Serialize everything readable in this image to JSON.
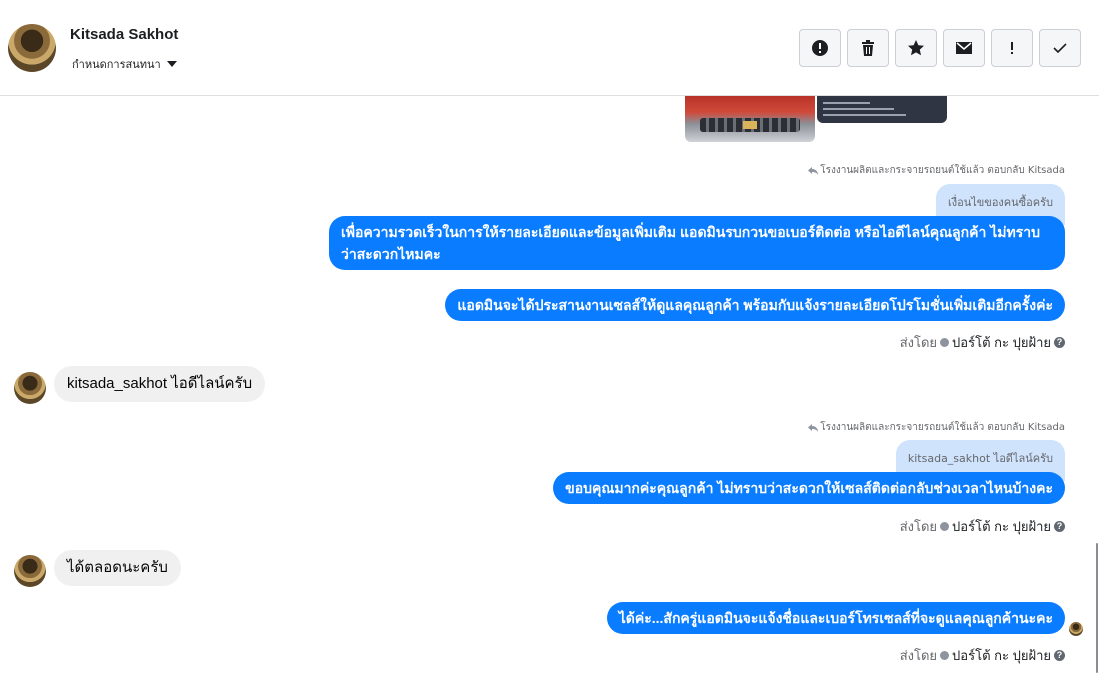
{
  "header": {
    "contact_name": "Kitsada Sakhot",
    "conversation_settings": "กำหนดการสนทนา",
    "actions": [
      {
        "name": "spam-button",
        "icon": "exclamation-circle-icon"
      },
      {
        "name": "delete-button",
        "icon": "trash-icon"
      },
      {
        "name": "star-button",
        "icon": "star-icon"
      },
      {
        "name": "mark-unread-button",
        "icon": "envelope-icon"
      },
      {
        "name": "important-button",
        "icon": "exclamation-icon"
      },
      {
        "name": "done-button",
        "icon": "checkmark-icon"
      }
    ]
  },
  "messages": {
    "reply1_meta": "โรงงานผลิตและกระจายรถยนต์ใช้แล้ว ตอบกลับ Kitsada",
    "reply1_quote": "เงื่อนไขของคนซื้อครับ",
    "out1": "เพื่อความรวดเร็วในการให้รายละเอียดและข้อมูลเพิ่มเติม แอดมินรบกวนขอเบอร์ติดต่อ หรือไอดีไลน์คุณลูกค้า ไม่ทราบว่าสะดวกไหมคะ",
    "out2": "แอดมินจะได้ประสานงานเซลส์ให้ดูแลคุณลูกค้า พร้อมกับแจ้งรายละเอียดโปรโมชั่นเพิ่มเติมอีกครั้งค่ะ",
    "in1": "kitsada_sakhot ไอดีไลน์ครับ",
    "reply2_meta": "โรงงานผลิตและกระจายรถยนต์ใช้แล้ว ตอบกลับ Kitsada",
    "reply2_quote": "kitsada_sakhot ไอดีไลน์ครับ",
    "out3": "ขอบคุณมากค่ะคุณลูกค้า ไม่ทราบว่าสะดวกให้เซลส์ติดต่อกลับช่วงเวลาไหนบ้างคะ",
    "in2": "ได้ตลอดนะครับ",
    "out4": "ได้ค่ะ...สักครู่แอดมินจะแจ้งชื่อและเบอร์โทรเซลส์ที่จะดูแลคุณลูกค้านะคะ"
  },
  "sent_by": {
    "prefix": "ส่งโดย",
    "name": "ปอร์โต้ กะ ปุยฝ้าย",
    "help": "?"
  },
  "colors": {
    "outgoing_bubble": "#0a7cff",
    "incoming_bubble": "#f0f0f0",
    "quote_bubble": "#cfe3fd"
  }
}
